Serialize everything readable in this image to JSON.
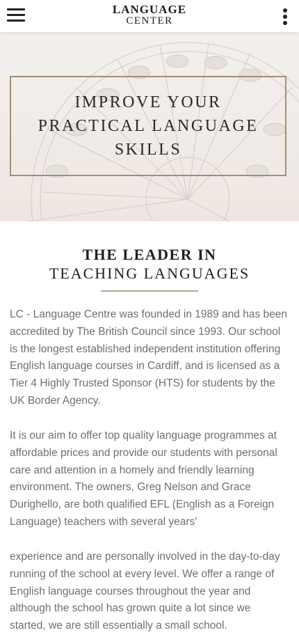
{
  "header": {
    "logo_line1": "LANGUAGE",
    "logo_line2": "CENTER",
    "menu_icon": "hamburger-menu-icon",
    "more_icon": "vertical-dots-icon"
  },
  "hero": {
    "title": "IMPROVE YOUR PRACTICAL LANGUAGE SKILLS",
    "frame_color": "#a18f73"
  },
  "about": {
    "heading_bold": "THE LEADER IN",
    "heading_light": "TEACHING LANGUAGES",
    "divider_color": "#b7a78d",
    "paragraphs": [
      "LC - Language Centre was founded in 1989 and has been accredited by The British Council since 1993. Our school is the longest established independent institution offering English language courses in Cardiff, and is licensed as a Tier 4 Highly Trusted Sponsor (HTS) for students by the UK Border Agency.",
      "It is our aim to offer top quality language programmes at affordable prices and provide our students with personal care and attention in a homely and friendly learning environment. The owners, Greg Nelson and Grace Durighello, are both qualified EFL (English as a Foreign Language) teachers with several years'",
      "experience and are personally involved in the day-to-day running of the school at every level. We offer a range of English language courses throughout the year and although the school has grown quite a lot since we started, we are still essentially a small school."
    ]
  }
}
